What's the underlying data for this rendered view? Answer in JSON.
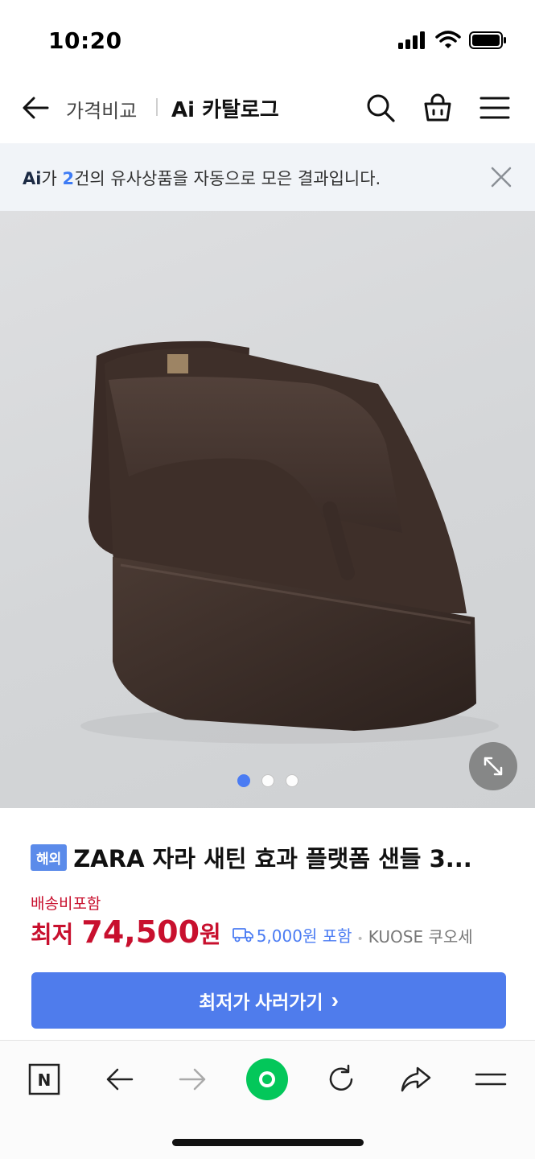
{
  "status_bar": {
    "time": "10:20"
  },
  "header": {
    "crumb_compare": "가격비교",
    "crumb_title": "Ai 카탈로그"
  },
  "ai_banner": {
    "logo": "Ai",
    "part1": "가 ",
    "count": "2",
    "part2": "건의 유사상품을 자동으로 모은 결과입니다."
  },
  "gallery": {
    "total_images": 3,
    "current_index": 1
  },
  "product": {
    "badge": "해외",
    "title": "ZARA 자라 새틴 효과 플랫폼 샌들 3...",
    "shipping_label": "배송비포함",
    "price_prefix": "최저",
    "price": "74,500",
    "price_unit": "원",
    "shipping_fee": "5,000원 포함",
    "seller": "KUOSE 쿠오세"
  },
  "actions": {
    "buy_label": "최저가 사러가기",
    "buy_chevron": "›"
  },
  "colors": {
    "accent": "#4f7cec",
    "price": "#c8102e",
    "banner_bg": "#f1f4f8",
    "naver_green": "#03c75a"
  },
  "toolbar": {
    "items": [
      "naver-n-icon",
      "back-arrow-icon",
      "forward-arrow-icon",
      "green-dot-icon",
      "refresh-icon",
      "share-icon",
      "menu-icon"
    ],
    "naver_label": "N"
  }
}
